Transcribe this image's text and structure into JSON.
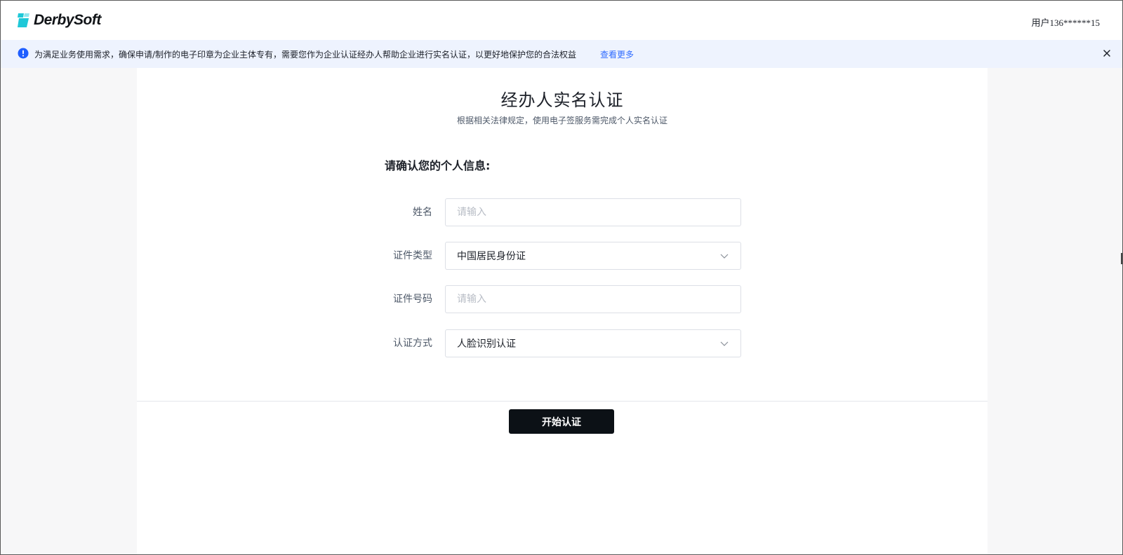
{
  "header": {
    "logo_text": "DerbySoft",
    "user_label": "用户136******15"
  },
  "notice": {
    "icon": "info-icon",
    "text": "为满足业务使用需求，确保申请/制作的电子印章为企业主体专有，需要您作为企业认证经办人帮助企业进行实名认证，以更好地保护您的合法权益",
    "link_label": "查看更多",
    "close_icon": "close-icon"
  },
  "main": {
    "title": "经办人实名认证",
    "subtitle": "根据相关法律规定，使用电子签服务需完成个人实名认证",
    "section_title": "请确认您的个人信息:",
    "fields": [
      {
        "label": "姓名",
        "type": "input",
        "value": "",
        "placeholder": "请输入"
      },
      {
        "label": "证件类型",
        "type": "select",
        "value": "中国居民身份证"
      },
      {
        "label": "证件号码",
        "type": "input",
        "value": "",
        "placeholder": "请输入"
      },
      {
        "label": "认证方式",
        "type": "select",
        "value": "人脸识别认证"
      }
    ],
    "submit_label": "开始认证"
  },
  "colors": {
    "brand_accent": "#1fc8d8",
    "link": "#2f6bff",
    "notice_bg": "#eef3fe",
    "button_bg": "#0c1116"
  }
}
